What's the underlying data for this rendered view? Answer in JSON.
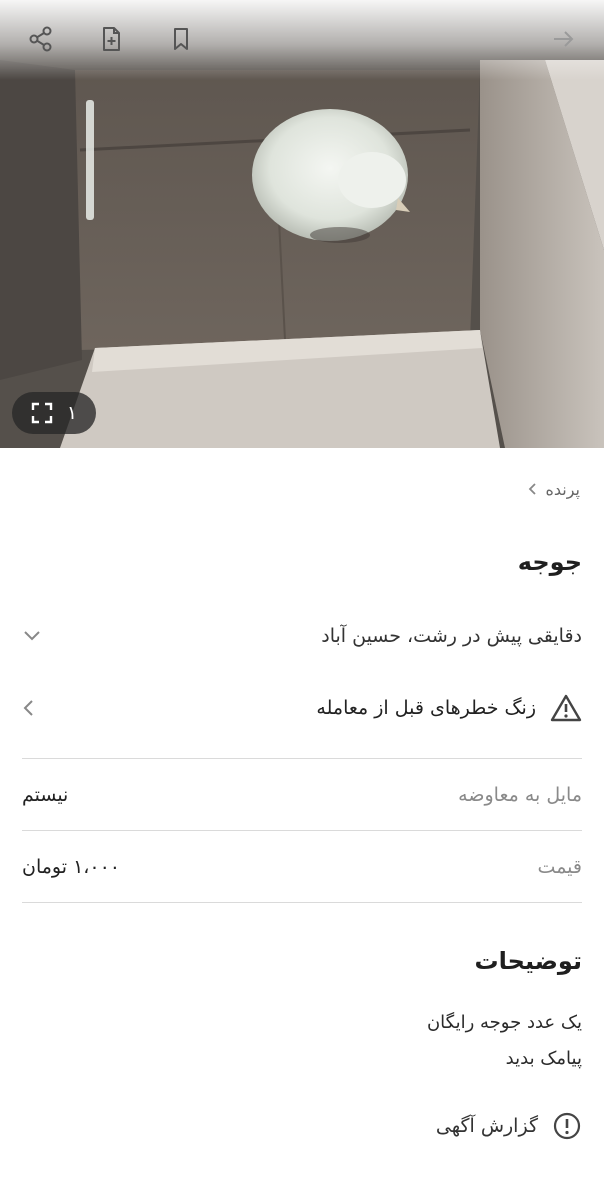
{
  "gallery": {
    "counter": "۱",
    "icons": [
      "share-icon",
      "add-note-icon",
      "bookmark-icon",
      "back-arrow-icon",
      "fullscreen-icon"
    ]
  },
  "breadcrumb": {
    "category": "پرنده"
  },
  "listing": {
    "title": "جوجه",
    "meta": "دقایقی پیش در رشت، حسین آباد",
    "warning": "زنگ خطرهای قبل از معامله"
  },
  "details": [
    {
      "label": "مایل به معاوضه",
      "value": "نیستم"
    },
    {
      "label": "قیمت",
      "value": "۱،۰۰۰ تومان"
    }
  ],
  "description": {
    "heading": "توضیحات",
    "lines": [
      "یک عدد جوجه رایگان",
      "پیامک بدید"
    ]
  },
  "report": {
    "label": "گزارش آگهی"
  },
  "colors": {
    "text": "#1f1f1f",
    "muted": "#8a8a8a",
    "divider": "#dadada"
  }
}
